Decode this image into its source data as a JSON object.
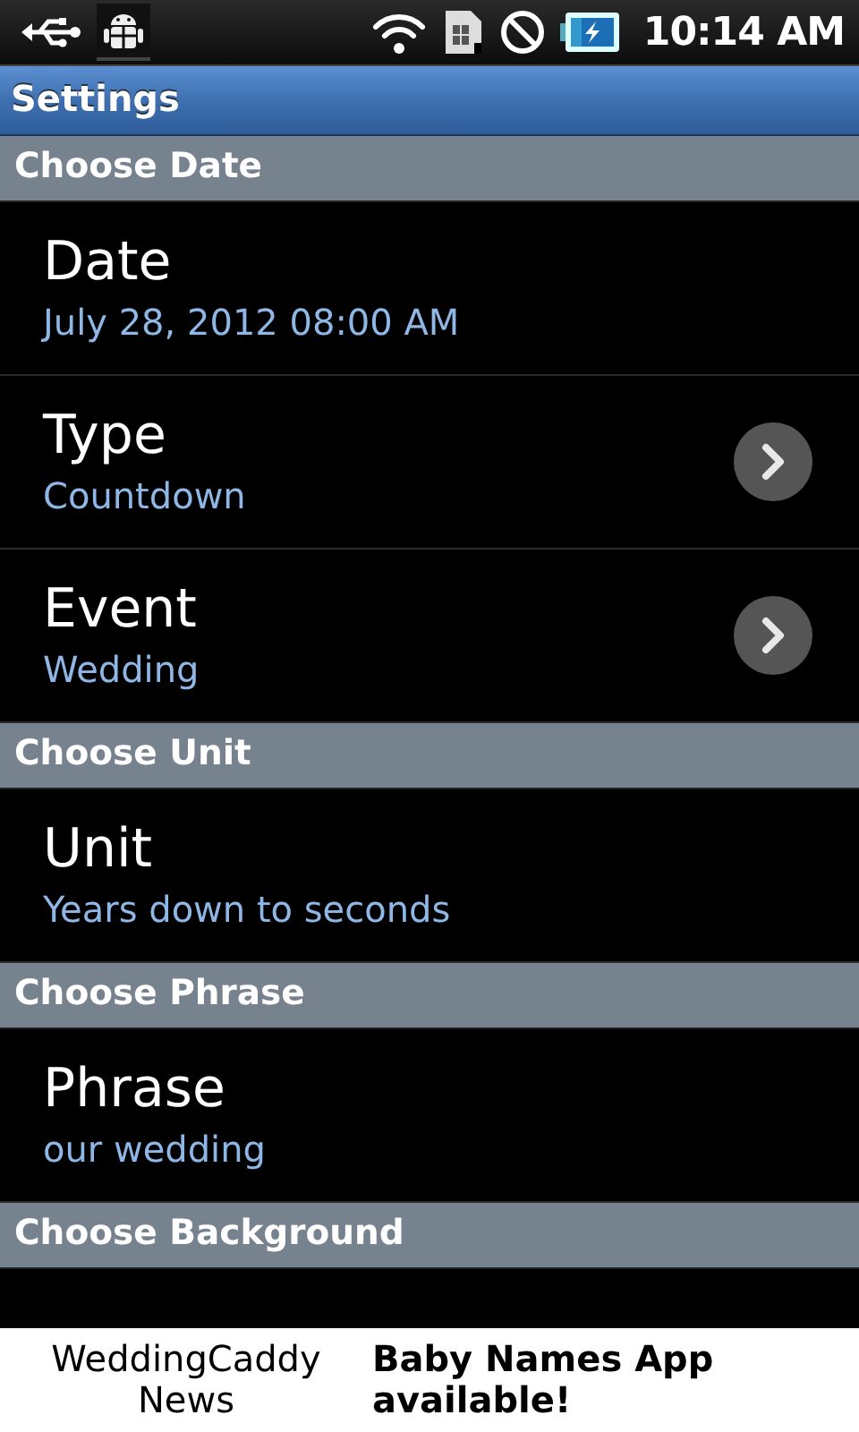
{
  "status_bar": {
    "time": "10:14 AM"
  },
  "title_bar": {
    "title": "Settings"
  },
  "sections": [
    {
      "header": "Choose Date",
      "items": [
        {
          "title": "Date",
          "summary": "July 28, 2012 08:00 AM",
          "kind": "plain"
        },
        {
          "title": "Type",
          "summary": "Countdown",
          "kind": "chevron"
        },
        {
          "title": "Event",
          "summary": "Wedding",
          "kind": "chevron"
        }
      ]
    },
    {
      "header": "Choose Unit",
      "items": [
        {
          "title": "Unit",
          "summary": "Years down to seconds",
          "kind": "plain"
        }
      ]
    },
    {
      "header": "Choose Phrase",
      "items": [
        {
          "title": "Phrase",
          "summary": "our wedding",
          "kind": "plain"
        }
      ]
    },
    {
      "header": "Choose Background"
    }
  ],
  "ad_banner": {
    "left_text": "WeddingCaddy News",
    "right_text": "Baby Names App available!"
  }
}
